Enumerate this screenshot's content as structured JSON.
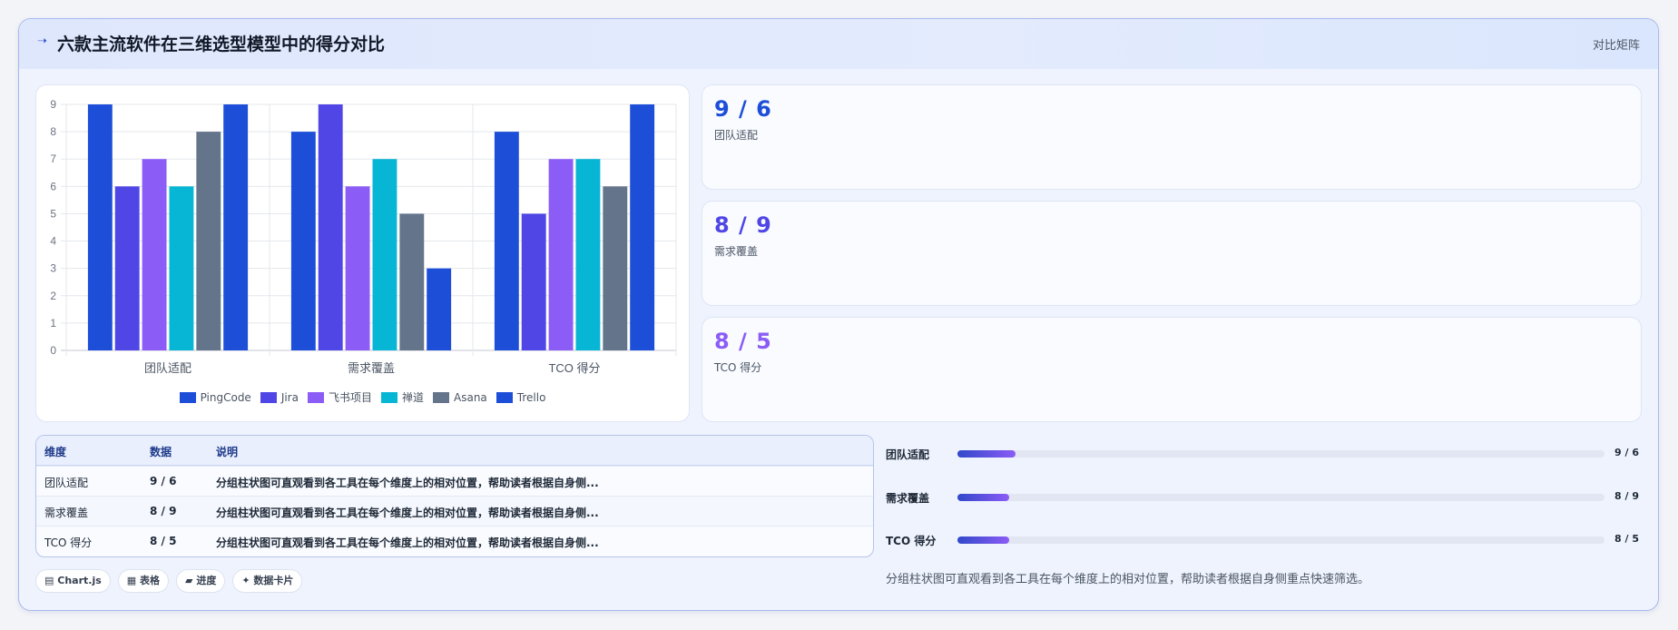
{
  "header": {
    "title": "六款主流软件在三维选型模型中的得分对比",
    "right_label": "对比矩阵"
  },
  "chart_data": {
    "type": "bar",
    "categories": [
      "团队适配",
      "需求覆盖",
      "TCO 得分"
    ],
    "series": [
      {
        "name": "PingCode",
        "color": "#1d4ed8",
        "values": [
          9,
          8,
          8
        ]
      },
      {
        "name": "Jira",
        "color": "#4f46e5",
        "values": [
          6,
          9,
          5
        ]
      },
      {
        "name": "飞书项目",
        "color": "#8b5cf6",
        "values": [
          7,
          6,
          7
        ]
      },
      {
        "name": "禅道",
        "color": "#06b6d4",
        "values": [
          6,
          7,
          7
        ]
      },
      {
        "name": "Asana",
        "color": "#64748b",
        "values": [
          8,
          5,
          6
        ]
      },
      {
        "name": "Trello",
        "color": "#1d4ed8",
        "values": [
          9,
          3,
          9
        ]
      }
    ],
    "ylim": [
      0,
      9
    ],
    "yticks": [
      "0",
      "1",
      "2",
      "3",
      "4",
      "5",
      "6",
      "7",
      "8",
      "9"
    ],
    "grid": true,
    "legend_position": "bottom"
  },
  "stats": [
    {
      "value": "9 / 6",
      "label": "团队适配",
      "color": "#1d4ed8"
    },
    {
      "value": "8 / 9",
      "label": "需求覆盖",
      "color": "#4f46e5"
    },
    {
      "value": "8 / 5",
      "label": "TCO 得分",
      "color": "#8b5cf6"
    }
  ],
  "table": {
    "headers": [
      "维度",
      "数据",
      "说明"
    ],
    "rows": [
      [
        "团队适配",
        "9 / 6",
        "分组柱状图可直观看到各工具在每个维度上的相对位置，帮助读者根据自身侧..."
      ],
      [
        "需求覆盖",
        "8 / 9",
        "分组柱状图可直观看到各工具在每个维度上的相对位置，帮助读者根据自身侧..."
      ],
      [
        "TCO 得分",
        "8 / 5",
        "分组柱状图可直观看到各工具在每个维度上的相对位置，帮助读者根据自身侧..."
      ]
    ]
  },
  "chips": [
    {
      "icon": "▤",
      "label": "Chart.js"
    },
    {
      "icon": "▦",
      "label": "表格"
    },
    {
      "icon": "▰",
      "label": "进度"
    },
    {
      "icon": "✦",
      "label": "数据卡片"
    }
  ],
  "progress": [
    {
      "label": "团队适配",
      "value": "9 / 6",
      "fraction": 0.09
    },
    {
      "label": "需求覆盖",
      "value": "8 / 9",
      "fraction": 0.08
    },
    {
      "label": "TCO 得分",
      "value": "8 / 5",
      "fraction": 0.08
    }
  ],
  "summary": "分组柱状图可直观看到各工具在每个维度上的相对位置，帮助读者根据自身侧重点快速筛选。"
}
